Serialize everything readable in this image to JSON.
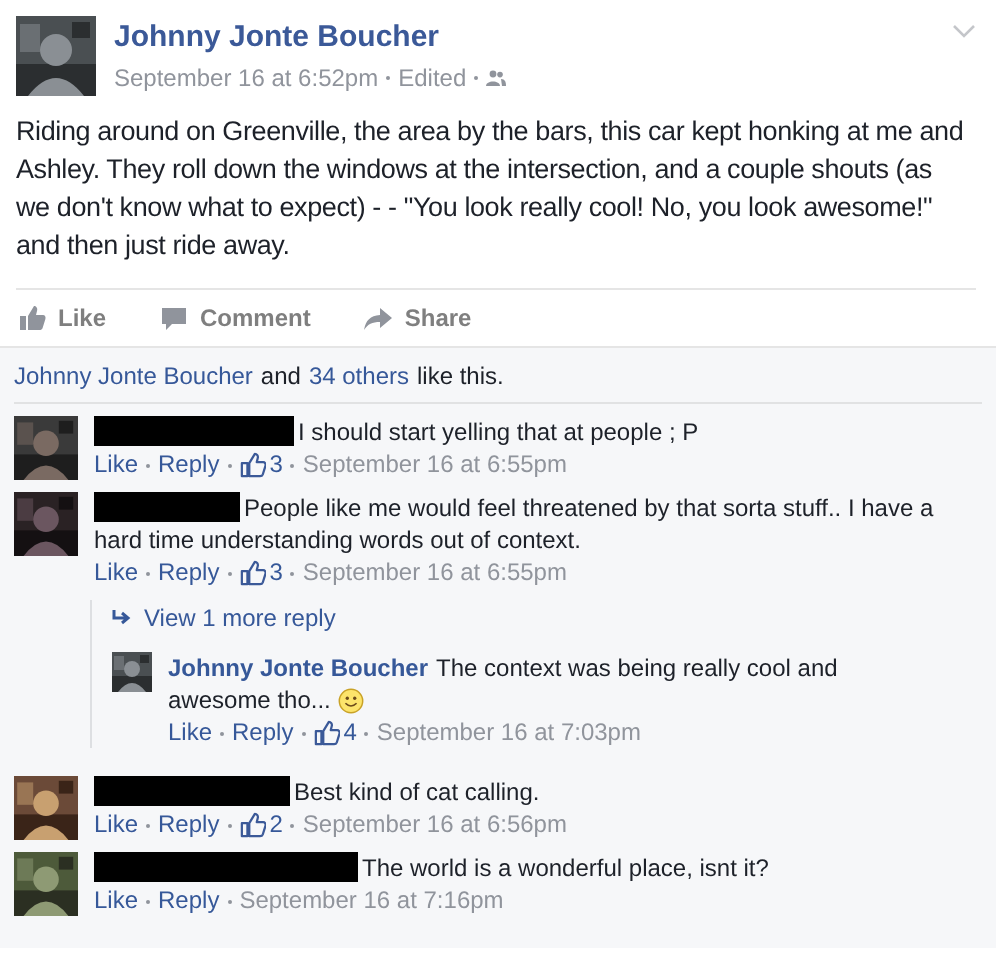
{
  "post": {
    "author": "Johnny Jonte Boucher",
    "date": "September 16 at 6:52pm",
    "edited": "Edited",
    "text": "Riding around on Greenville, the area by the bars, this car kept honking at me and Ashley. They roll down the windows at the intersection, and a couple shouts (as we don't know what to expect) - - \"You look really cool! No, you look awesome!\" and then just ride away."
  },
  "actions": [
    "Like",
    "Comment",
    "Share"
  ],
  "likes": {
    "name": "Johnny Jonte Boucher",
    "middle": "and",
    "others": "34 others",
    "end": "like this."
  },
  "comments": [
    {
      "kind": "redacted",
      "text": "I should start yelling that at people ; P",
      "like": "Like",
      "reply": "Reply",
      "count": "3",
      "date": "September 16 at 6:55pm"
    },
    {
      "kind": "redacted",
      "text": "People like me would feel threatened by that sorta stuff.. I have a hard time understanding words out of context.",
      "like": "Like",
      "reply": "Reply",
      "count": "3",
      "date": "September 16 at 6:55pm",
      "more_replies": "View 1 more reply",
      "replies": [
        {
          "kind": "named",
          "author": "Johnny Jonte Boucher",
          "text": "The context was being really cool and awesome tho...",
          "emoji": true,
          "like": "Like",
          "reply": "Reply",
          "count": "4",
          "date": "September 16 at 7:03pm"
        }
      ]
    },
    {
      "kind": "redacted",
      "text": "Best kind of cat calling.",
      "like": "Like",
      "reply": "Reply",
      "count": "2",
      "date": "September 16 at 6:56pm"
    },
    {
      "kind": "redacted",
      "text": "The world is a wonderful place, isnt it?",
      "like": "Like",
      "reply": "Reply",
      "date": "September 16 at 7:16pm"
    }
  ]
}
